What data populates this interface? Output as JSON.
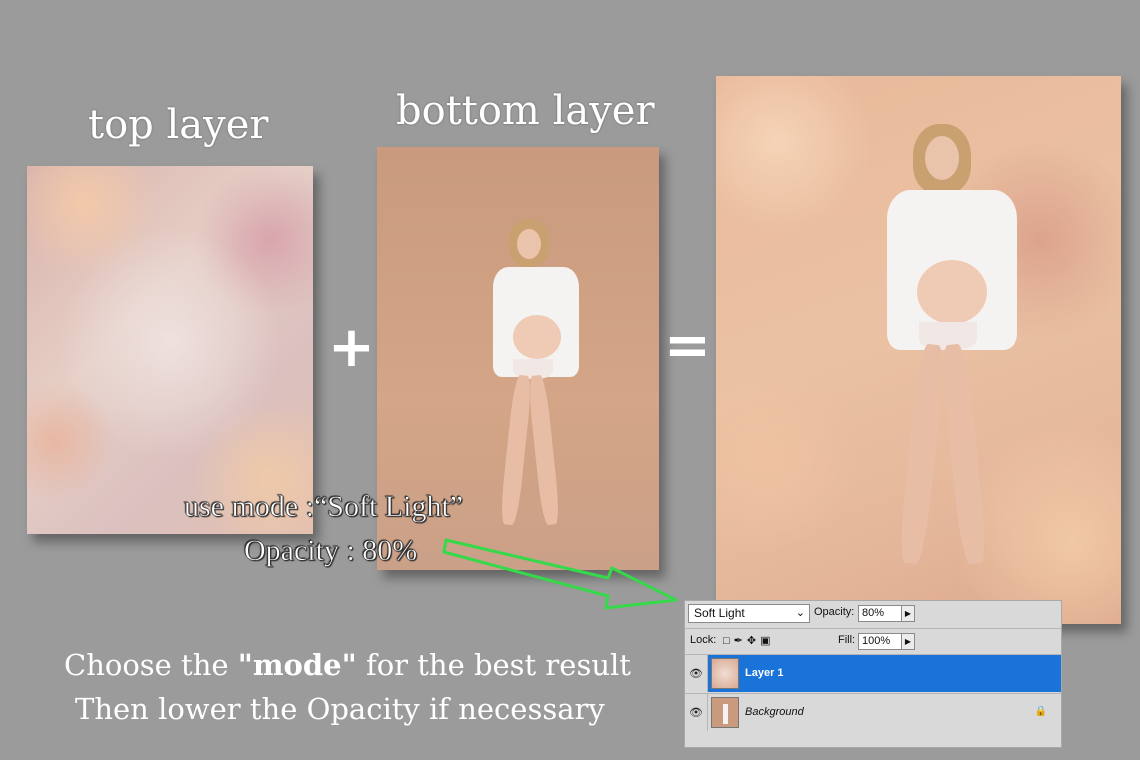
{
  "captions": {
    "top_layer": "top layer",
    "bottom_layer": "bottom layer"
  },
  "operators": {
    "plus": "+",
    "equals": "="
  },
  "hints": {
    "mode": "use mode :“Soft Light”",
    "opacity": "Opacity : 80%"
  },
  "instructions": {
    "line1_pre": "Choose the ",
    "line1_bold": "\"mode\"",
    "line1_post": " for the best result",
    "line2": "Then lower the Opacity if necessary"
  },
  "layers_panel": {
    "blend_mode": "Soft Light",
    "opacity_label": "Opacity:",
    "opacity_value": "80%",
    "lock_label": "Lock:",
    "fill_label": "Fill:",
    "fill_value": "100%",
    "layers": [
      {
        "name": "Layer 1",
        "selected": true
      },
      {
        "name": "Background",
        "selected": false
      }
    ]
  },
  "colors": {
    "background": "#9b9b9b",
    "arrow": "#35d94a",
    "selected_layer": "#1a73d9"
  }
}
